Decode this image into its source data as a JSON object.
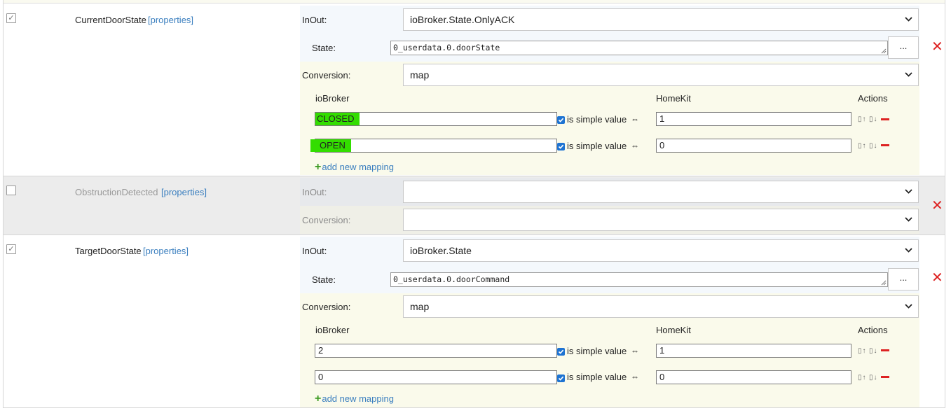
{
  "rows": [
    {
      "enabled": true,
      "name": "CurrentDoorState",
      "properties_link": "[properties]",
      "inout_label": "InOut:",
      "inout_value": "ioBroker.State.OnlyACK",
      "state_label": "State:",
      "state_value": "0_userdata.0.doorState",
      "dots_label": "...",
      "conversion_label": "Conversion:",
      "conversion_value": "map",
      "mapping_headers": {
        "iobroker": "ioBroker",
        "homekit": "HomeKit",
        "actions": "Actions"
      },
      "mappings": [
        {
          "iobroker": "CLOSED",
          "simple_checked": true,
          "simple_label": "is simple value",
          "homekit": "1"
        },
        {
          "iobroker": "OPEN",
          "simple_checked": true,
          "simple_label": "is simple value",
          "homekit": "0"
        }
      ],
      "add_mapping_label": "add new mapping"
    },
    {
      "enabled": false,
      "name": "ObstructionDetected",
      "properties_link": "[properties]",
      "inout_label": "InOut:",
      "inout_value": "",
      "conversion_label": "Conversion:",
      "conversion_value": ""
    },
    {
      "enabled": true,
      "name": "TargetDoorState",
      "properties_link": "[properties]",
      "inout_label": "InOut:",
      "inout_value": "ioBroker.State",
      "state_label": "State:",
      "state_value": "0_userdata.0.doorCommand",
      "dots_label": "...",
      "conversion_label": "Conversion:",
      "conversion_value": "map",
      "mapping_headers": {
        "iobroker": "ioBroker",
        "homekit": "HomeKit",
        "actions": "Actions"
      },
      "mappings": [
        {
          "iobroker": "2",
          "simple_checked": true,
          "simple_label": "is simple value",
          "homekit": "1"
        },
        {
          "iobroker": "0",
          "simple_checked": true,
          "simple_label": "is simple value",
          "homekit": "0"
        }
      ],
      "add_mapping_label": "add new mapping"
    }
  ],
  "symbols": {
    "equivalence": "⇔",
    "check": "✓",
    "delete": "✕",
    "sort_up": "▯↑",
    "sort_down": "▯↓"
  },
  "colors": {
    "link": "#3b7fbf",
    "delete": "#dd2222",
    "add": "#3a9a20",
    "highlight": "#33dd00",
    "checkbox_checked": "#1e73d2"
  }
}
